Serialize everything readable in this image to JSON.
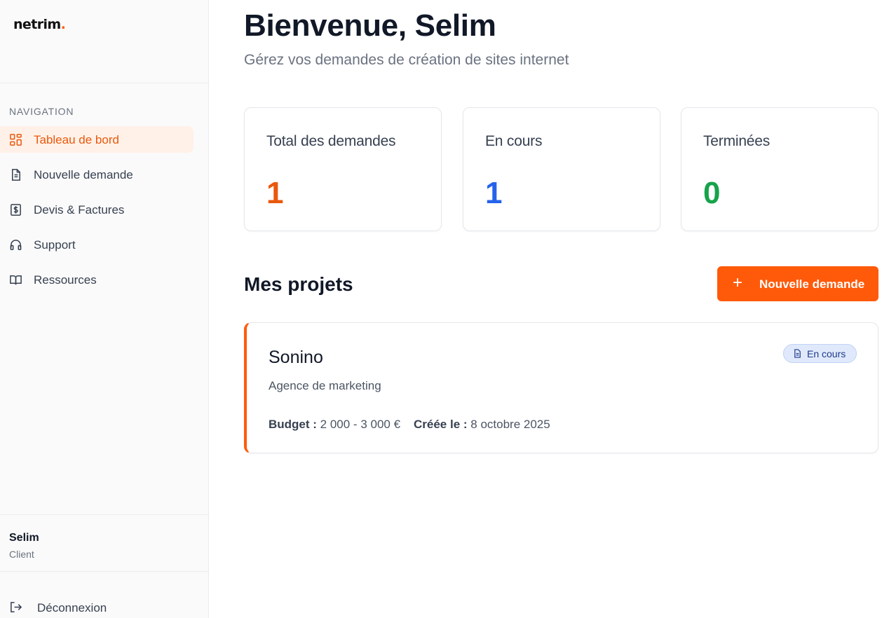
{
  "brand": {
    "name": "netrim",
    "dot": ".",
    "accent": "#ff5a0a"
  },
  "sidebar": {
    "heading": "NAVIGATION",
    "items": [
      {
        "label": "Tableau de bord",
        "icon": "dashboard-grid-icon",
        "active": true
      },
      {
        "label": "Nouvelle demande",
        "icon": "document-icon"
      },
      {
        "label": "Devis & Factures",
        "icon": "invoice-dollar-icon"
      },
      {
        "label": "Support",
        "icon": "headphones-icon"
      },
      {
        "label": "Ressources",
        "icon": "open-book-icon"
      }
    ],
    "user": {
      "name": "Selim",
      "role": "Client"
    },
    "logout_label": "Déconnexion"
  },
  "header": {
    "title": "Bienvenue, Selim",
    "subtitle": "Gérez vos demandes de création de sites internet"
  },
  "stats": [
    {
      "label": "Total des demandes",
      "value": "1",
      "color": "#ea580c"
    },
    {
      "label": "En cours",
      "value": "1",
      "color": "#2563eb"
    },
    {
      "label": "Terminées",
      "value": "0",
      "color": "#16a34a"
    }
  ],
  "projects": {
    "title": "Mes projets",
    "new_button": "Nouvelle demande",
    "items": [
      {
        "name": "Sonino",
        "description": "Agence de marketing",
        "status": "En cours",
        "budget_label": "Budget :",
        "budget": "2 000 - 3 000 €",
        "created_label": "Créée le :",
        "created": "8 octobre 2025"
      }
    ]
  }
}
